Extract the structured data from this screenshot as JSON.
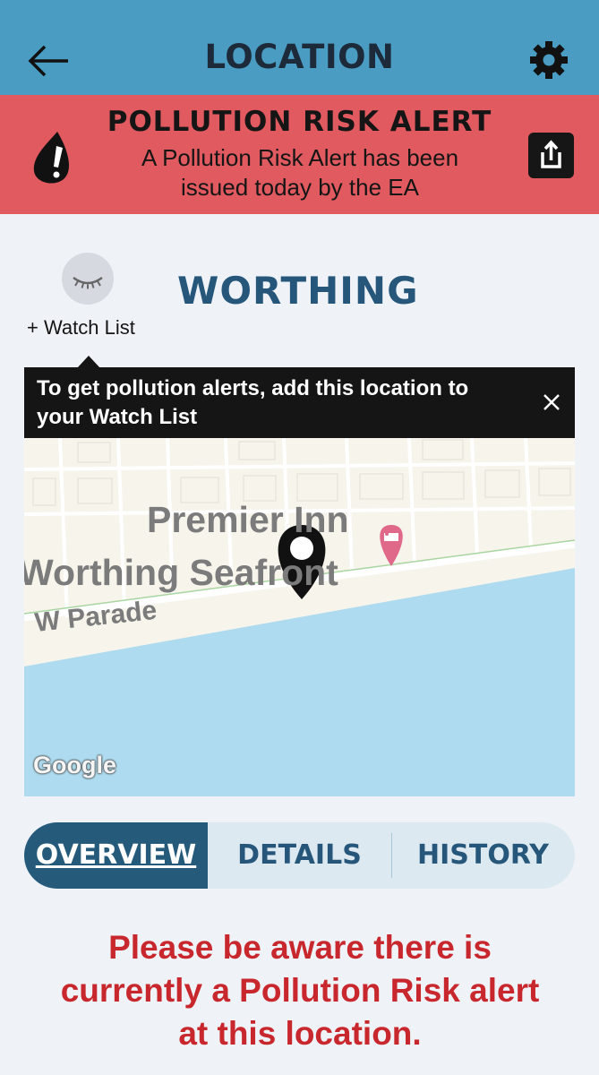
{
  "header": {
    "title": "LOCATION",
    "back_icon": "arrow-left-icon",
    "settings_icon": "gear-icon",
    "bg_color": "#4a9cc3"
  },
  "alert_banner": {
    "title": "POLLUTION RISK ALERT",
    "message": "A Pollution Risk Alert has been issued today by the EA",
    "icon": "alert-drop-icon",
    "share_icon": "share-icon",
    "bg_color": "#e05a60"
  },
  "location": {
    "name": "WORTHING",
    "watch_list_label": "+ Watch List",
    "watch_icon": "closed-eye-icon"
  },
  "tooltip": {
    "text": "To get pollution alerts, add this location to your Watch List",
    "close_icon": "close-icon"
  },
  "map": {
    "poi_name_line1": "Premier Inn",
    "poi_name_line2": "Worthing Seafront",
    "street_name": "W Parade",
    "attribution": "Google",
    "marker_icon": "map-pin-icon",
    "poi_icon": "hotel-pin-icon",
    "sea_color": "#aedbef",
    "land_color": "#f7f4ec"
  },
  "tabs": [
    {
      "label": "OVERVIEW",
      "active": true
    },
    {
      "label": "DETAILS",
      "active": false
    },
    {
      "label": "HISTORY",
      "active": false
    }
  ],
  "notice": {
    "text": "Please be aware there is currently a Pollution Risk alert at this location.",
    "color": "#c8282d"
  }
}
